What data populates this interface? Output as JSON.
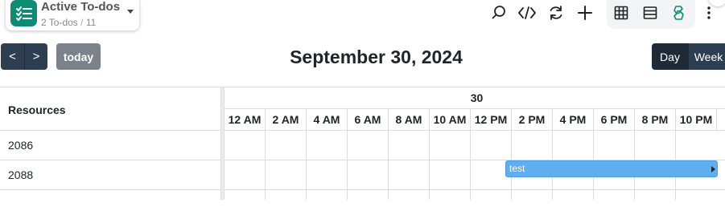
{
  "view": {
    "title": "Active To-dos",
    "count_label": "2 To-dos",
    "separator": "/",
    "total": "11",
    "icon": "checklist-icon"
  },
  "toolbar": {
    "icons": [
      "search-icon",
      "code-icon",
      "refresh-icon",
      "add-icon",
      "grid-view-icon",
      "list-view-icon",
      "calendar-view-icon",
      "more-vertical-icon"
    ]
  },
  "calendar": {
    "prev_label": "<",
    "next_label": ">",
    "today_label": "today",
    "title": "September 30, 2024",
    "views": {
      "day": "Day",
      "week": "Week"
    },
    "resources_header": "Resources",
    "day_label": "30",
    "time_slots": [
      "12 AM",
      "2 AM",
      "4 AM",
      "6 AM",
      "8 AM",
      "10 AM",
      "12 PM",
      "2 PM",
      "4 PM",
      "6 PM",
      "8 PM",
      "10 PM"
    ],
    "resources": [
      "2086",
      "2088"
    ],
    "events": [
      {
        "title": "test",
        "resource": "2088",
        "start": "1:00 PM",
        "continues": true
      }
    ]
  },
  "colors": {
    "brand": "#0f8a74",
    "button_dark": "#2c3e50",
    "button_today": "#7b8289",
    "event": "#5eaef0"
  }
}
